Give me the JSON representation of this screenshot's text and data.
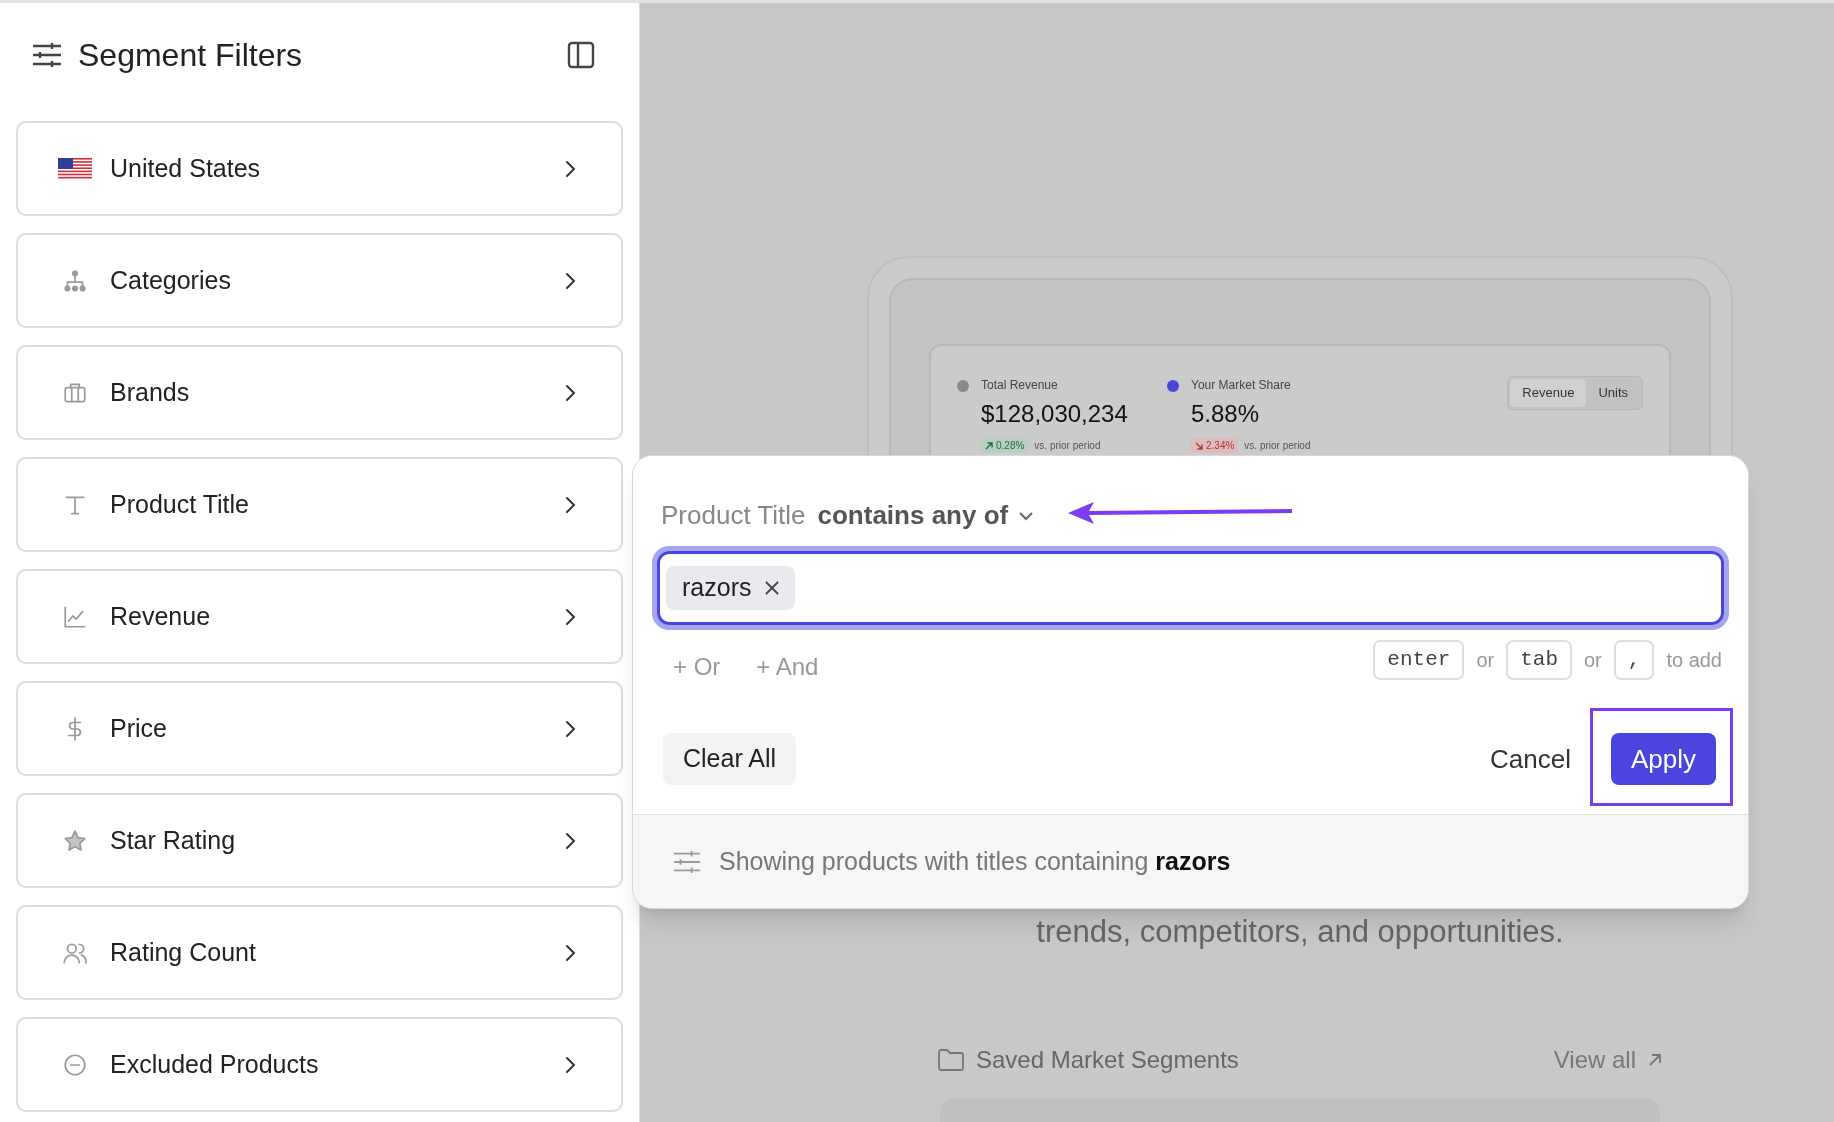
{
  "sidebar": {
    "title": "Segment Filters",
    "items": [
      {
        "label": "United States",
        "kind": "flag"
      },
      {
        "label": "Categories",
        "kind": "hierarchy"
      },
      {
        "label": "Brands",
        "kind": "briefcase"
      },
      {
        "label": "Product Title",
        "kind": "text"
      },
      {
        "label": "Revenue",
        "kind": "chart"
      },
      {
        "label": "Price",
        "kind": "dollar"
      },
      {
        "label": "Star Rating",
        "kind": "star"
      },
      {
        "label": "Rating Count",
        "kind": "users"
      },
      {
        "label": "Excluded Products",
        "kind": "minus"
      }
    ]
  },
  "preview": {
    "metrics": [
      {
        "label": "Total Revenue",
        "value": "$128,030,234",
        "change": "0.28%",
        "rising": true,
        "caption": "vs. prior period",
        "color": "#8a8a8a"
      },
      {
        "label": "Your Market Share",
        "value": "5.88%",
        "change": "2.34%",
        "rising": false,
        "caption": "vs. prior period",
        "color": "#4a45d6"
      }
    ],
    "toggle": [
      {
        "label": "Revenue",
        "selected": true
      },
      {
        "label": "Units",
        "selected": false
      }
    ],
    "tagline": "trends, competitors, and opportunities.",
    "saved_title": "Saved Market Segments",
    "view_all": "View all"
  },
  "dialog": {
    "field": "Product Title",
    "operator": "contains any of",
    "tags": [
      "razors"
    ],
    "add_buttons": [
      "+ Or",
      "+ And"
    ],
    "hint": {
      "keys": [
        "enter",
        "tab",
        ","
      ],
      "separators": [
        "or",
        "or"
      ],
      "suffix": "to add"
    },
    "clear": "Clear All",
    "cancel": "Cancel",
    "apply": "Apply",
    "summary": "Showing products with titles containing **razors**"
  }
}
